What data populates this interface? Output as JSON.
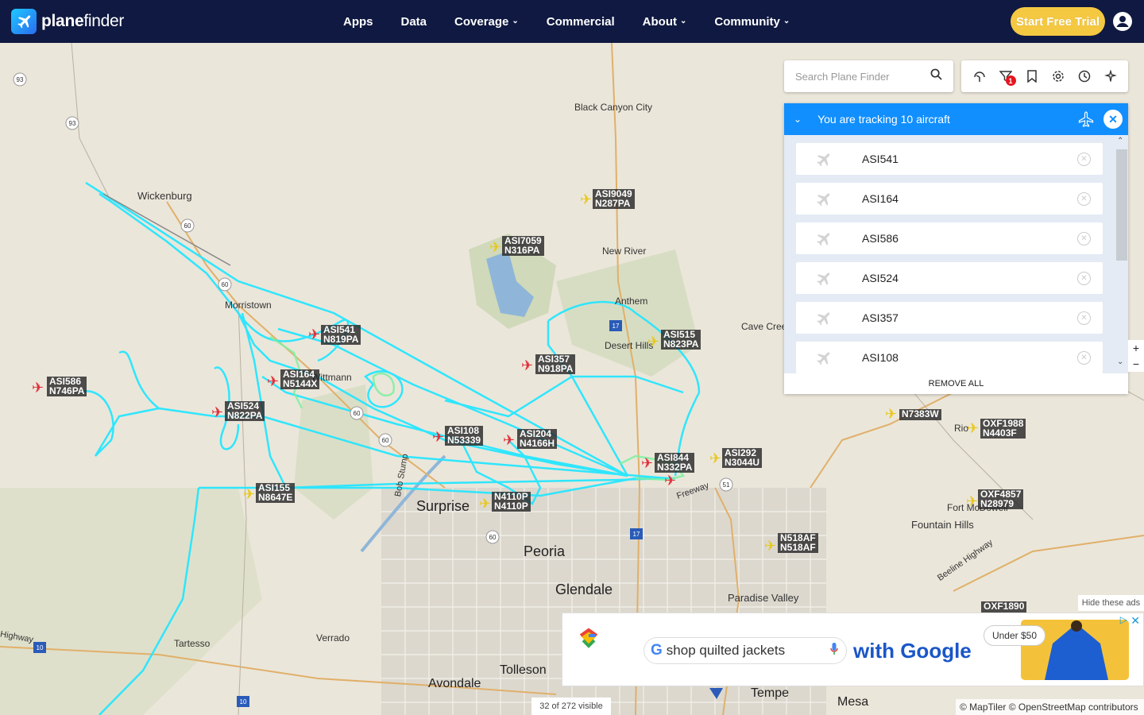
{
  "nav": {
    "logo_bold": "plane",
    "logo_light": "finder",
    "items": [
      {
        "label": "Apps",
        "dropdown": false
      },
      {
        "label": "Data",
        "dropdown": false
      },
      {
        "label": "Coverage",
        "dropdown": true
      },
      {
        "label": "Commercial",
        "dropdown": false
      },
      {
        "label": "About",
        "dropdown": true
      },
      {
        "label": "Community",
        "dropdown": true
      }
    ],
    "cta": "Start Free Trial"
  },
  "search": {
    "placeholder": "Search Plane Finder"
  },
  "toolbar": {
    "filter_badge": "1"
  },
  "tracking": {
    "title": "You are tracking 10 aircraft",
    "items": [
      "ASI541",
      "ASI164",
      "ASI586",
      "ASI524",
      "ASI357",
      "ASI108"
    ],
    "remove_all": "REMOVE ALL"
  },
  "zoom": {
    "plus": "+",
    "minus": "−"
  },
  "map": {
    "places": [
      "Black Canyon City",
      "Wickenburg",
      "New River",
      "Morristown",
      "Anthem",
      "Cave Creek",
      "Desert Hills",
      "Surprise",
      "Peoria",
      "Glendale",
      "Fountain Hills",
      "Paradise Valley",
      "Tartesso",
      "Verrado",
      "Tolleson",
      "Avondale",
      "Tempe",
      "Mesa",
      "Fort McDowell",
      "Rio",
      "Bob Stump",
      "Highway",
      "Beeline Highway",
      "Wittmann",
      "Freeway"
    ],
    "aircraft": [
      {
        "callsign": "ASI9049",
        "reg": "N287PA"
      },
      {
        "callsign": "ASI7059",
        "reg": "N316PA"
      },
      {
        "callsign": "ASI541",
        "reg": "N819PA"
      },
      {
        "callsign": "ASI515",
        "reg": "N823PA"
      },
      {
        "callsign": "ASI357",
        "reg": "N918PA"
      },
      {
        "callsign": "ASI586",
        "reg": "N746PA"
      },
      {
        "callsign": "ASI164",
        "reg": "N5144X"
      },
      {
        "callsign": "ASI524",
        "reg": "N822PA"
      },
      {
        "callsign": "ASI108",
        "reg": "N53339"
      },
      {
        "callsign": "ASI204",
        "reg": "N4166H"
      },
      {
        "callsign": "ASI844",
        "reg": "N332PA"
      },
      {
        "callsign": "ASI292",
        "reg": "N3044U"
      },
      {
        "callsign": "ASI155",
        "reg": "N8647E"
      },
      {
        "callsign": "N4110P",
        "reg": "N4110P"
      },
      {
        "callsign": "N7383W",
        "reg": ""
      },
      {
        "callsign": "OXF1988",
        "reg": "N4403F"
      },
      {
        "callsign": "OXF4857",
        "reg": "N28979"
      },
      {
        "callsign": "N518AF",
        "reg": "N518AF"
      },
      {
        "callsign": "OXF1890",
        "reg": ""
      }
    ],
    "highways": [
      "93",
      "93",
      "60",
      "60",
      "60",
      "60",
      "17",
      "17",
      "51",
      "10",
      "10"
    ]
  },
  "ads": {
    "hide": "Hide these ads",
    "query": "shop quilted jackets",
    "with": "with Google",
    "price": "Under $50"
  },
  "status": {
    "visible": "32 of 272 visible"
  },
  "attribution": "© MapTiler © OpenStreetMap contributors"
}
